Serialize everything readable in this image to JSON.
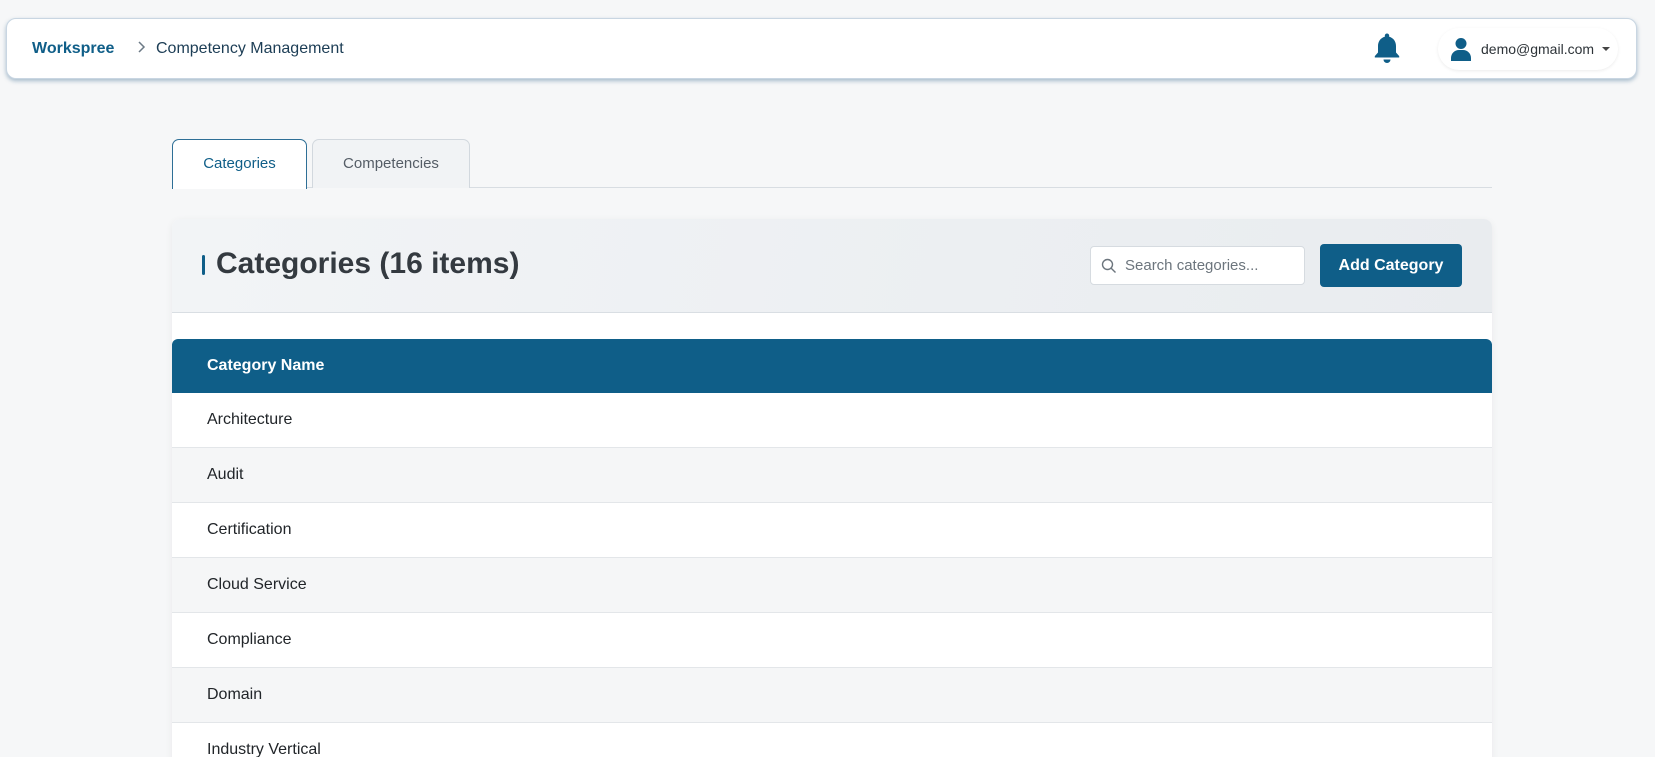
{
  "header": {
    "brand": "Workspree",
    "breadcrumb_current": "Competency Management",
    "user_email": "demo@gmail.com"
  },
  "tabs": [
    {
      "label": "Categories",
      "active": true
    },
    {
      "label": "Competencies",
      "active": false
    }
  ],
  "card": {
    "title": "Categories (16 items)",
    "search_placeholder": "Search categories...",
    "add_button": "Add Category"
  },
  "table": {
    "header": "Category Name",
    "rows": [
      "Architecture",
      "Audit",
      "Certification",
      "Cloud Service",
      "Compliance",
      "Domain",
      "Industry Vertical"
    ]
  },
  "colors": {
    "primary": "#0f5e88",
    "background": "#f6f7f8",
    "row_alt": "#f5f6f7"
  },
  "icons": [
    "chevron-right-icon",
    "bell-icon",
    "user-icon",
    "caret-down-icon",
    "search-icon"
  ]
}
